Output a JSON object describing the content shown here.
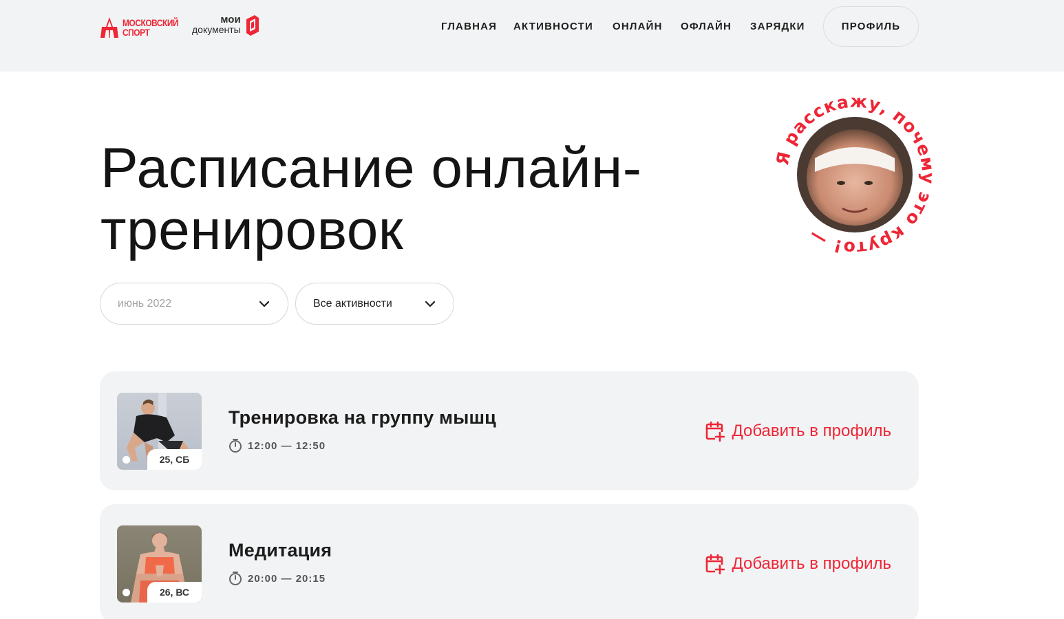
{
  "brand": {
    "moscow_sport_line1": "МОСКОВСКИЙ",
    "moscow_sport_line2": "СПОРТ",
    "my_docs_line1": "мои",
    "my_docs_line2": "документы",
    "accent_color": "#ee2636"
  },
  "nav": {
    "items": [
      "ГЛАВНАЯ",
      "АКТИВНОСТИ",
      "ОНЛАЙН",
      "ОФЛАЙН",
      "ЗАРЯДКИ"
    ],
    "profile_label": "ПРОФИЛЬ"
  },
  "page": {
    "title_line1": "Расписание онлайн-",
    "title_line2": "тренировок"
  },
  "badge": {
    "circle_text": "Я расскажу, почему это круто! —"
  },
  "filters": {
    "month_value": "июнь 2022",
    "activity_value": "Все активности"
  },
  "sessions": [
    {
      "title": "Тренировка на группу мышц",
      "time": "12:00 — 12:50",
      "date": "25, СБ",
      "add_label": "Добавить в профиль"
    },
    {
      "title": "Медитация",
      "time": "20:00 — 20:15",
      "date": "26, ВС",
      "add_label": "Добавить в профиль"
    }
  ],
  "icons": [
    "chevron-down-icon",
    "stopwatch-icon",
    "calendar-add-icon"
  ]
}
